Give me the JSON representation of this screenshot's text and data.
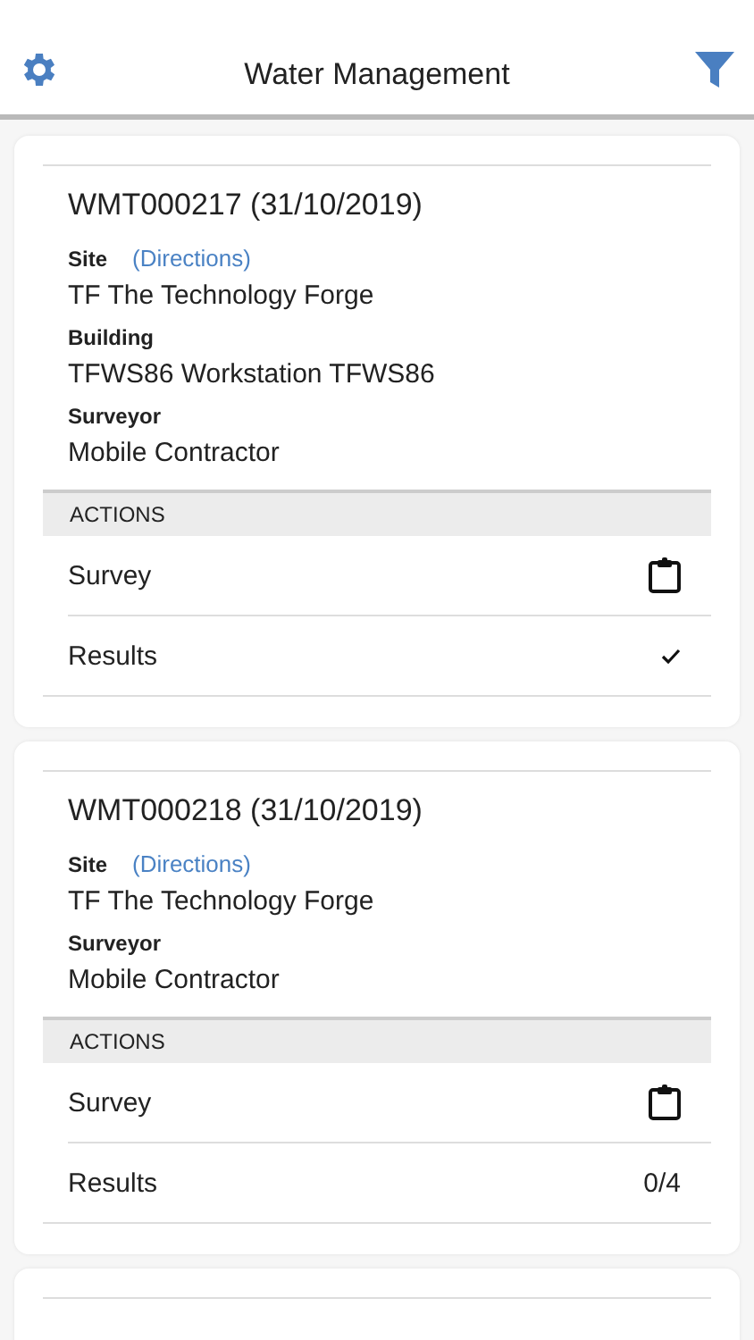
{
  "header": {
    "title": "Water Management"
  },
  "cards": [
    {
      "title": "WMT000217 (31/10/2019)",
      "fields": [
        {
          "label": "Site",
          "link": "(Directions)",
          "value": "TF The Technology Forge"
        },
        {
          "label": "Building",
          "value": "TFWS86 Workstation TFWS86"
        },
        {
          "label": "Surveyor",
          "value": "Mobile Contractor"
        }
      ],
      "actions_title": "ACTIONS",
      "actions": [
        {
          "label": "Survey",
          "kind": "clipboard"
        },
        {
          "label": "Results",
          "kind": "done"
        }
      ]
    },
    {
      "title": "WMT000218 (31/10/2019)",
      "fields": [
        {
          "label": "Site",
          "link": "(Directions)",
          "value": "TF The Technology Forge"
        },
        {
          "label": "Surveyor",
          "value": "Mobile Contractor"
        }
      ],
      "actions_title": "ACTIONS",
      "actions": [
        {
          "label": "Survey",
          "kind": "clipboard"
        },
        {
          "label": "Results",
          "kind": "count",
          "value": "0/4"
        }
      ]
    }
  ]
}
